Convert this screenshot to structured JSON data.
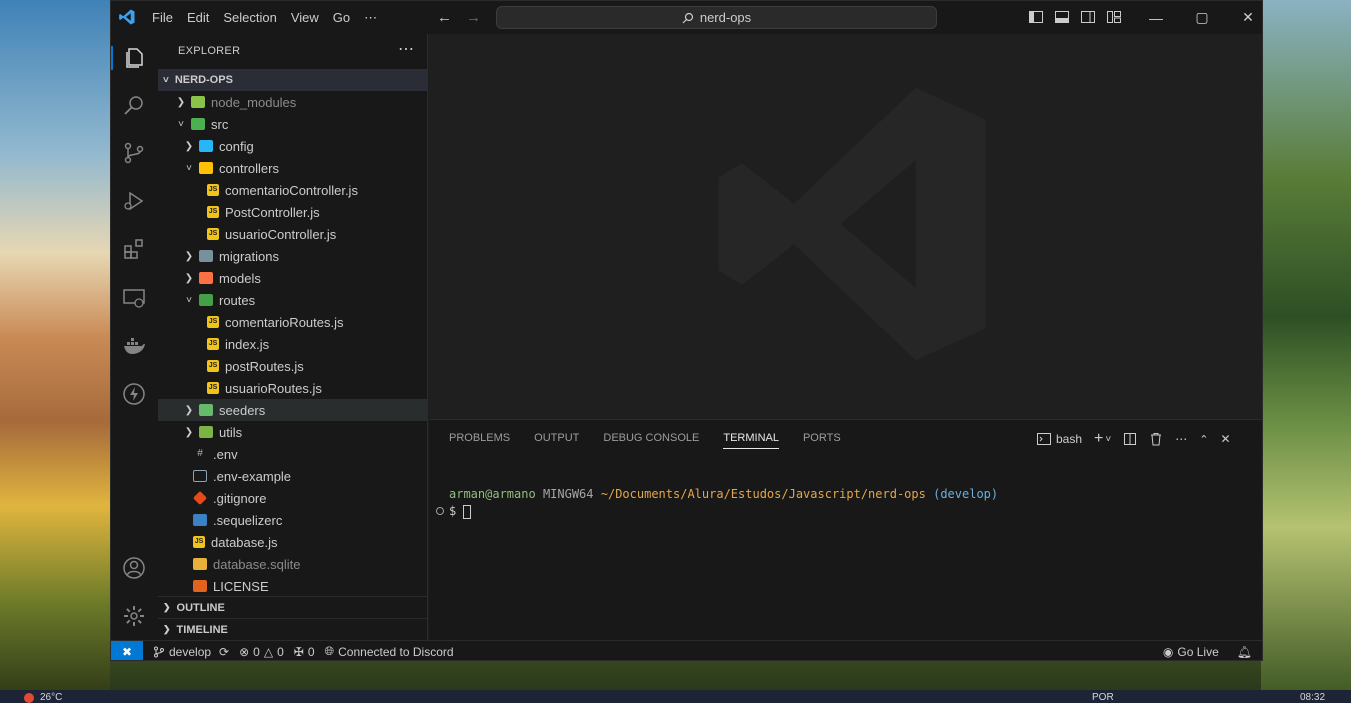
{
  "titlebar": {
    "menu": [
      "File",
      "Edit",
      "Selection",
      "View",
      "Go",
      "⋯"
    ],
    "search": "nerd-ops",
    "controls": {
      "minimize": "—",
      "maximize": "▢",
      "close": "✕"
    }
  },
  "explorer": {
    "title": "EXPLORER",
    "more": "⋯",
    "root": "NERD-OPS",
    "items": [
      {
        "label": "node_modules",
        "depth": 0,
        "chevron": "›",
        "icon": "folder-node-icon"
      },
      {
        "label": "src",
        "depth": 0,
        "chevron": "˅",
        "icon": "folder-src-icon"
      },
      {
        "label": "config",
        "depth": 1,
        "chevron": "›",
        "icon": "folder-config-icon"
      },
      {
        "label": "controllers",
        "depth": 1,
        "chevron": "˅",
        "icon": "folder-controllers-icon"
      },
      {
        "label": "comentarioController.js",
        "depth": 2,
        "icon": "js-file-icon"
      },
      {
        "label": "PostController.js",
        "depth": 2,
        "icon": "js-file-icon"
      },
      {
        "label": "usuarioController.js",
        "depth": 2,
        "icon": "js-file-icon"
      },
      {
        "label": "migrations",
        "depth": 1,
        "chevron": "›",
        "icon": "folder-migrations-icon"
      },
      {
        "label": "models",
        "depth": 1,
        "chevron": "›",
        "icon": "folder-models-icon"
      },
      {
        "label": "routes",
        "depth": 1,
        "chevron": "˅",
        "icon": "folder-routes-icon"
      },
      {
        "label": "comentarioRoutes.js",
        "depth": 2,
        "icon": "js-file-icon"
      },
      {
        "label": "index.js",
        "depth": 2,
        "icon": "js-file-icon"
      },
      {
        "label": "postRoutes.js",
        "depth": 2,
        "icon": "js-file-icon"
      },
      {
        "label": "usuarioRoutes.js",
        "depth": 2,
        "icon": "js-file-icon"
      },
      {
        "label": "seeders",
        "depth": 1,
        "chevron": "›",
        "icon": "folder-seeders-icon"
      },
      {
        "label": "utils",
        "depth": 1,
        "chevron": "›",
        "icon": "folder-utils-icon"
      },
      {
        "label": ".env",
        "depth": 0,
        "icon": "env-file-icon"
      },
      {
        "label": ".env-example",
        "depth": 0,
        "icon": "file-icon"
      },
      {
        "label": ".gitignore",
        "depth": 0,
        "icon": "git-icon"
      },
      {
        "label": ".sequelizerc",
        "depth": 0,
        "icon": "sequelize-icon"
      },
      {
        "label": "database.js",
        "depth": 0,
        "icon": "js-file-icon"
      },
      {
        "label": "database.sqlite",
        "depth": 0,
        "icon": "database-icon"
      },
      {
        "label": "LICENSE",
        "depth": 0,
        "icon": "license-icon"
      }
    ],
    "outline": "OUTLINE",
    "timeline": "TIMELINE"
  },
  "panel": {
    "tabs": [
      "PROBLEMS",
      "OUTPUT",
      "DEBUG CONSOLE",
      "TERMINAL",
      "PORTS"
    ],
    "active_tab": "TERMINAL",
    "shell": "bash",
    "terminal": {
      "user": "arman@armano",
      "host": "MINGW64",
      "path": "~/Documents/Alura/Estudos/Javascript/nerd-ops",
      "branch": "(develop)",
      "prompt": "$"
    }
  },
  "status": {
    "branch": "develop",
    "errors": "0",
    "warnings": "0",
    "ports": "0",
    "discord": "Connected to Discord",
    "golive": "Go Live"
  },
  "taskbar": {
    "temp": "26°C",
    "lang": "POR",
    "time": "08:32"
  }
}
